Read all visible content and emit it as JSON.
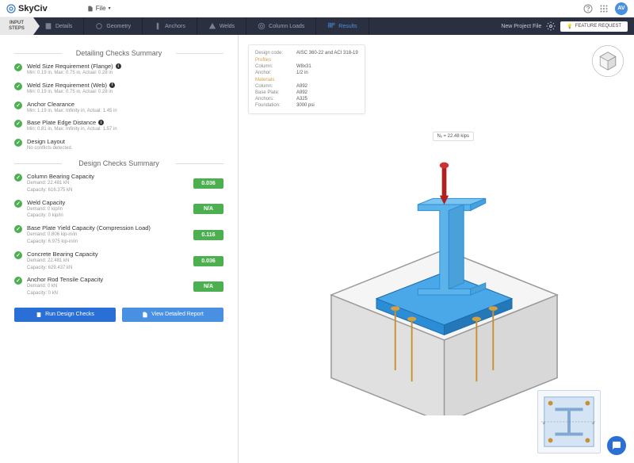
{
  "topbar": {
    "brand": "SkyCiv",
    "file_label": "File",
    "avatar": "AV"
  },
  "nav": {
    "input_steps": "INPUT\nSTEPS",
    "items": [
      {
        "label": "Details"
      },
      {
        "label": "Geometry"
      },
      {
        "label": "Anchors"
      },
      {
        "label": "Welds"
      },
      {
        "label": "Column Loads"
      },
      {
        "label": "Results"
      }
    ],
    "project_link": "New Project File",
    "feature_btn": "FEATURE REQUEST"
  },
  "detailing": {
    "title": "Detailing Checks Summary",
    "items": [
      {
        "title": "Weld Size Requirement (Flange)",
        "sub": "Min: 0.19 in, Max: 0.75 in, Actual: 0.28 in",
        "info": true
      },
      {
        "title": "Weld Size Requirement (Web)",
        "sub": "Min: 0.19 in, Max: 0.75 in, Actual: 0.28 in",
        "info": true
      },
      {
        "title": "Anchor Clearance",
        "sub": "Min: 1.19 in, Max: Infinity in, Actual: 1.45 in"
      },
      {
        "title": "Base Plate Edge Distance",
        "sub": "Min: 0.81 in, Max: Infinity in, Actual: 1.57 in",
        "info": true
      },
      {
        "title": "Design Layout",
        "sub": "No conflicts detected."
      }
    ]
  },
  "design": {
    "title": "Design Checks Summary",
    "items": [
      {
        "title": "Column Bearing Capacity",
        "sub1": "Demand: 22.481 kN",
        "sub2": "Capacity: 616.375 kN",
        "ratio": "0.036"
      },
      {
        "title": "Weld Capacity",
        "sub1": "Demand: 0 kip/in",
        "sub2": "Capacity: 0 kip/in",
        "ratio": "N/A"
      },
      {
        "title": "Base Plate Yield Capacity (Compression Load)",
        "sub1": "Demand: 0.806 kip-in/in",
        "sub2": "Capacity: 6.975 kip-in/in",
        "ratio": "0.116"
      },
      {
        "title": "Concrete Bearing Capacity",
        "sub1": "Demand: 22.481 kN",
        "sub2": "Capacity: 629.437 kN",
        "ratio": "0.036"
      },
      {
        "title": "Anchor Rod Tensile Capacity",
        "sub1": "Demand: 0 kN",
        "sub2": "Capacity: 0 kN",
        "ratio": "N/A"
      }
    ]
  },
  "buttons": {
    "run": "Run Design Checks",
    "report": "View Detailed Report"
  },
  "info_card": {
    "rows": [
      {
        "label": "Design code:",
        "value": "AISC 360-22 and ACI 318-19"
      }
    ],
    "profiles_label": "Profiles",
    "profiles": [
      {
        "label": "Column:",
        "value": "W8x31"
      },
      {
        "label": "Anchor:",
        "value": "1/2 in"
      }
    ],
    "materials_label": "Materials",
    "materials": [
      {
        "label": "Column:",
        "value": "A992"
      },
      {
        "label": "Base Plate:",
        "value": "A992"
      },
      {
        "label": "Anchors:",
        "value": "A325"
      },
      {
        "label": "Foundation:",
        "value": "3000 psi"
      }
    ]
  },
  "load_label": "Nₓ = 22.48 kips"
}
